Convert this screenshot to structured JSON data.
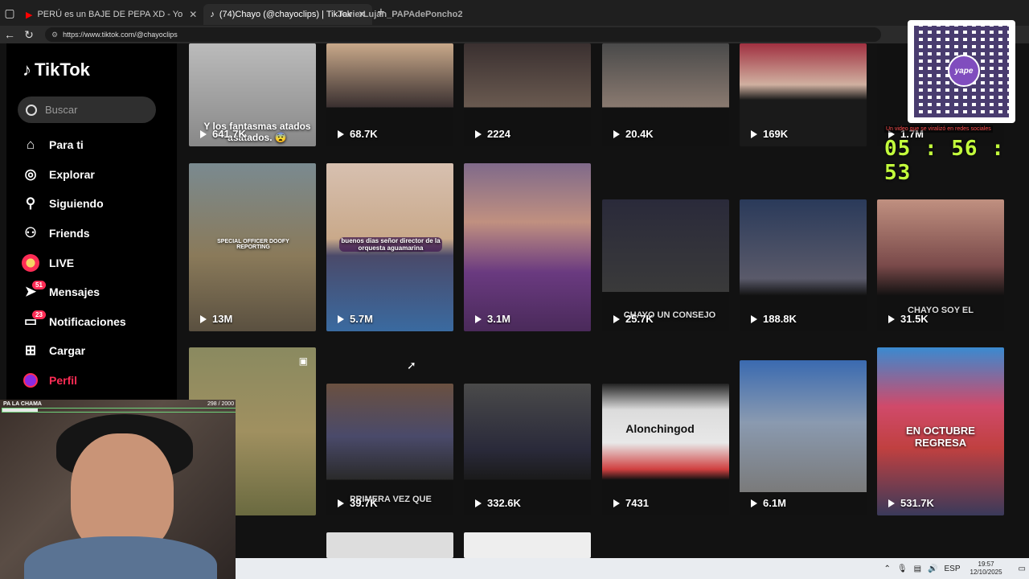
{
  "browser": {
    "tabs": [
      {
        "title": "PERÚ es un BAJE DE PEPA XD - Yo",
        "icon": "youtube-icon"
      },
      {
        "title": "(74)Chayo (@chayoclips) | TikTok",
        "icon": "tiktok-icon"
      }
    ],
    "overlay_name": "JavierLujan_PAPAdePoncho2",
    "url": "https://www.tiktok.com/@chayoclips"
  },
  "tiktok": {
    "logo": "TikTok",
    "search_placeholder": "Buscar",
    "nav": [
      {
        "label": "Para ti",
        "icon": "home-icon"
      },
      {
        "label": "Explorar",
        "icon": "compass-icon"
      },
      {
        "label": "Siguiendo",
        "icon": "following-icon"
      },
      {
        "label": "Friends",
        "icon": "friends-icon"
      },
      {
        "label": "LIVE",
        "icon": "live-icon"
      },
      {
        "label": "Mensajes",
        "icon": "messages-icon",
        "badge": "51"
      },
      {
        "label": "Notificaciones",
        "icon": "notifications-icon",
        "badge": "23"
      },
      {
        "label": "Cargar",
        "icon": "upload-icon"
      },
      {
        "label": "Perfil",
        "icon": "profile-icon"
      }
    ]
  },
  "videos": [
    {
      "views": "641.7K",
      "caption": "Y los fantasmas atados asatados. 😨"
    },
    {
      "views": "68.7K"
    },
    {
      "views": "2224"
    },
    {
      "views": "20.4K"
    },
    {
      "views": "169K"
    },
    {
      "views": "1.7M"
    },
    {
      "views": "13M",
      "caption": "SPECIAL OFFICER DOOFY REPORTING"
    },
    {
      "views": "5.7M",
      "caption": "buenos dias señor director de la orquesta aguamarina"
    },
    {
      "views": "3.1M"
    },
    {
      "views": "25.7K",
      "caption": "CHAYO UN CONSEJO"
    },
    {
      "views": "188.8K"
    },
    {
      "views": "31.5K",
      "caption": "CHAYO SOY EL"
    },
    {
      "views": "39.7K",
      "caption": "PRIMERA VEZ QUE"
    },
    {
      "views": "332.6K"
    },
    {
      "views": "7431",
      "caption": "Alonchingod"
    },
    {
      "views": "6.1M"
    },
    {
      "views": "531.7K",
      "caption": "EN OCTUBRE REGRESA"
    }
  ],
  "stream": {
    "qr_label": "yape",
    "viral_text": "Un video que se viralizó en redes sociales",
    "timer": "05 : 56 : 53",
    "cam_label": "PA LA CHAMA",
    "cam_count": "298 / 2000",
    "progress": 0.149
  },
  "taskbar": {
    "lang": "ESP",
    "time": "19:57",
    "date": "12/10/2025"
  }
}
